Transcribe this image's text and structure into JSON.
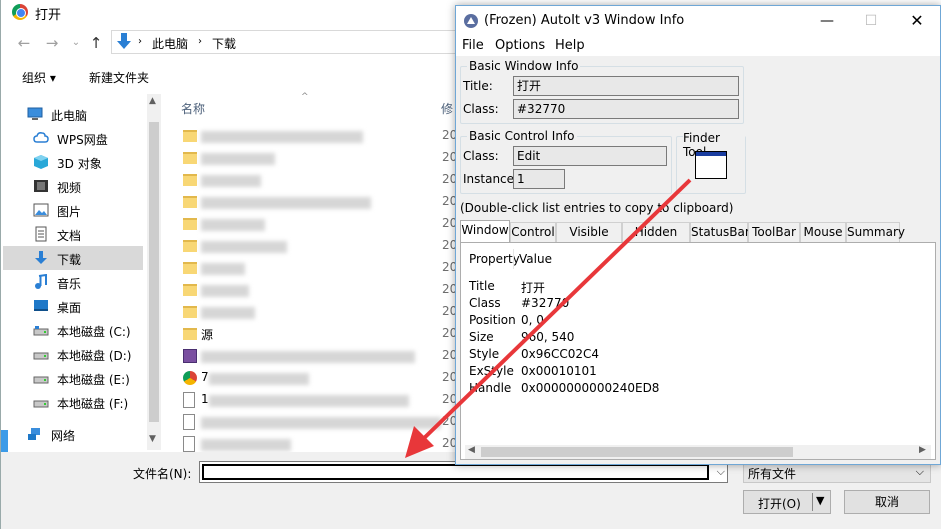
{
  "dialog": {
    "title": "打开",
    "breadcrumb": [
      "此电脑",
      "下载"
    ],
    "toolbar": {
      "organize": "组织 ▾",
      "new_folder": "新建文件夹"
    },
    "nav_items": [
      {
        "label": "此电脑",
        "icon": "computer-icon"
      },
      {
        "label": "WPS网盘",
        "icon": "cloud-icon"
      },
      {
        "label": "3D 对象",
        "icon": "cube-icon"
      },
      {
        "label": "视频",
        "icon": "video-icon"
      },
      {
        "label": "图片",
        "icon": "picture-icon"
      },
      {
        "label": "文档",
        "icon": "document-icon"
      },
      {
        "label": "下载",
        "icon": "download-icon"
      },
      {
        "label": "音乐",
        "icon": "music-icon"
      },
      {
        "label": "桌面",
        "icon": "desktop-icon"
      },
      {
        "label": "本地磁盘 (C:)",
        "icon": "drive-icon"
      },
      {
        "label": "本地磁盘 (D:)",
        "icon": "drive-icon"
      },
      {
        "label": "本地磁盘 (E:)",
        "icon": "drive-icon"
      },
      {
        "label": "本地磁盘 (F:)",
        "icon": "drive-icon"
      },
      {
        "label": "网络",
        "icon": "network-icon"
      }
    ],
    "column_name": "名称",
    "column_date": "修",
    "date_prefix": "20",
    "file_name_label": "文件名(N):",
    "file_type": "所有文件",
    "open_button": "打开(O)",
    "cancel_button": "取消",
    "folder_partial": "源",
    "file_partial_0": "7",
    "file_partial_1": "1"
  },
  "autoit": {
    "title": "(Frozen) AutoIt v3 Window Info",
    "menu": [
      "File",
      "Options",
      "Help"
    ],
    "basic_window": {
      "group": "Basic Window Info",
      "title_label": "Title:",
      "title_value": "打开",
      "class_label": "Class:",
      "class_value": "#32770"
    },
    "basic_control": {
      "group": "Basic Control Info",
      "class_label": "Class:",
      "class_value": "Edit",
      "instance_label": "Instance:",
      "instance_value": "1"
    },
    "finder_tool": "Finder Tool",
    "hint": "(Double-click list entries to copy to clipboard)",
    "tabs": [
      "Window",
      "Control",
      "Visible Text",
      "Hidden Text",
      "StatusBar",
      "ToolBar",
      "Mouse",
      "Summary"
    ],
    "list_headers": {
      "property": "Property",
      "value": "Value"
    },
    "rows": [
      {
        "k": "Title",
        "v": "打开"
      },
      {
        "k": "Class",
        "v": "#32770"
      },
      {
        "k": "Position",
        "v": "0, 0"
      },
      {
        "k": "Size",
        "v": "960, 540"
      },
      {
        "k": "Style",
        "v": "0x96CC02C4"
      },
      {
        "k": "ExStyle",
        "v": "0x00010101"
      },
      {
        "k": "Handle",
        "v": "0x0000000000240ED8"
      }
    ]
  },
  "colors": {
    "arrow": "#e8373a",
    "selection": "#d9d9d9"
  }
}
